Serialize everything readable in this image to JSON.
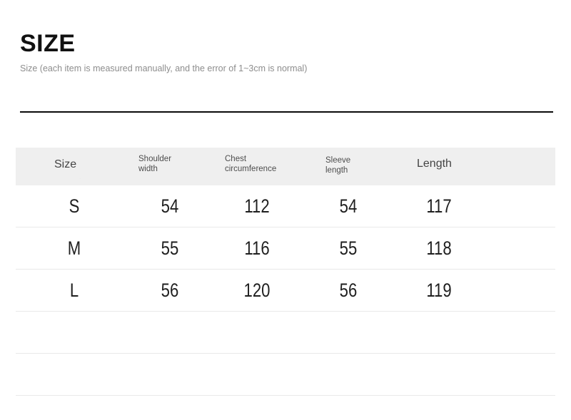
{
  "heading": {
    "title": "SIZE",
    "subtitle": "Size (each item is measured manually, and the error of 1~3cm is normal)"
  },
  "table": {
    "headers": [
      "Size",
      "Shoulder\nwidth",
      "Chest\ncircumference",
      "Sleeve\nlength",
      "Length"
    ],
    "header_lines": {
      "size": "Size",
      "shoulder_1": "Shoulder",
      "shoulder_2": "width",
      "chest_1": "Chest",
      "chest_2": "circumference",
      "sleeve_1": "Sleeve",
      "sleeve_2": "length",
      "length": "Length"
    },
    "rows": [
      {
        "size": "S",
        "shoulder_width": "54",
        "chest_circumference": "112",
        "sleeve_length": "54",
        "length": "117"
      },
      {
        "size": "M",
        "shoulder_width": "55",
        "chest_circumference": "116",
        "sleeve_length": "55",
        "length": "118"
      },
      {
        "size": "L",
        "shoulder_width": "56",
        "chest_circumference": "120",
        "sleeve_length": "56",
        "length": "119"
      }
    ],
    "empty_row_count": 2
  },
  "colors": {
    "title_text": "#111111",
    "subtitle_text": "#8d8d8d",
    "header_band": "#efefef",
    "header_text": "#4a4a4a",
    "value_text": "#1f1f1f",
    "divider": "#e9e9e9",
    "rule_thick": "#0a0a0a",
    "background": "#ffffff"
  }
}
